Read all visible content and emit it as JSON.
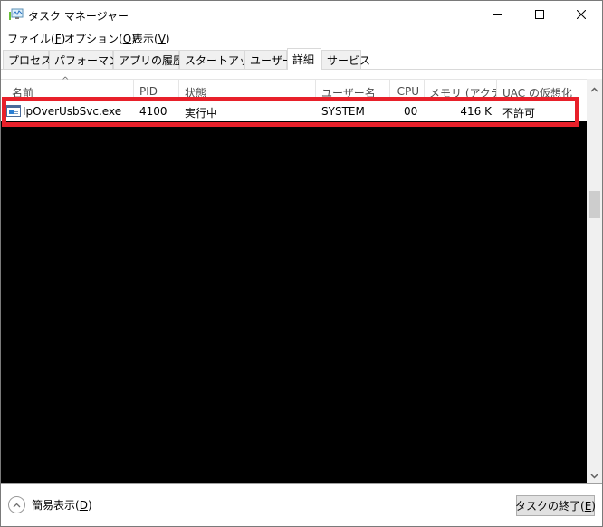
{
  "window": {
    "title": "タスク マネージャー",
    "app_icon": "task-manager-icon",
    "controls": {
      "minimize": "minimize-icon",
      "maximize": "maximize-icon",
      "close": "close-icon"
    }
  },
  "menu": {
    "items": [
      {
        "label": "ファイル(",
        "key": "F",
        "suffix": ")"
      },
      {
        "label": "オプション(",
        "key": "O",
        "suffix": ")"
      },
      {
        "label": "表示(",
        "key": "V",
        "suffix": ")"
      }
    ]
  },
  "tabs": [
    {
      "label": "プロセス",
      "active": false
    },
    {
      "label": "パフォーマンス",
      "active": false
    },
    {
      "label": "アプリの履歴",
      "active": false
    },
    {
      "label": "スタートアップ",
      "active": false
    },
    {
      "label": "ユーザー",
      "active": false
    },
    {
      "label": "詳細",
      "active": true
    },
    {
      "label": "サービス",
      "active": false
    }
  ],
  "table": {
    "sort_indicator": "^",
    "columns": [
      "名前",
      "PID",
      "状態",
      "ユーザー名",
      "CPU",
      "メモリ (アクテ...",
      "UAC の仮想化"
    ],
    "rows": [
      {
        "name": "IpOverUsbSvc.exe",
        "pid": "4100",
        "status": "実行中",
        "user": "SYSTEM",
        "cpu": "00",
        "memory": "416 K",
        "uac": "不許可",
        "highlighted": true
      }
    ],
    "highlight_color": "#e8202a"
  },
  "footer": {
    "fewer_details_label": "簡易表示(",
    "fewer_details_key": "D",
    "fewer_details_suffix": ")",
    "end_task_label": "タスクの終了(",
    "end_task_key": "E",
    "end_task_suffix": ")"
  }
}
